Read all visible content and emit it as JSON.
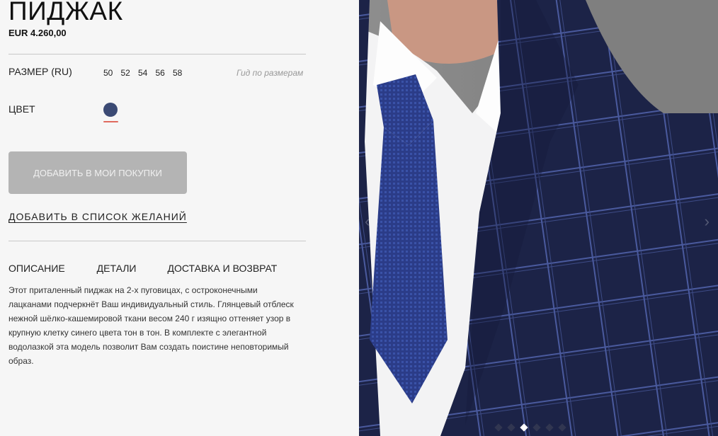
{
  "product": {
    "title": "ПИДЖАК",
    "price": "EUR 4.260,00"
  },
  "size": {
    "label": "РАЗМЕР (RU)",
    "options": [
      "50",
      "52",
      "54",
      "56",
      "58"
    ],
    "guide": "Гид по размерам"
  },
  "color": {
    "label": "ЦВЕТ",
    "swatch_hex": "#3b4a74",
    "selected_marker_hex": "#e06a5e"
  },
  "actions": {
    "add_to_cart": "ДОБАВИТЬ В МОИ ПОКУПКИ",
    "add_to_wishlist": "ДОБАВИТЬ В СПИСОК ЖЕЛАНИЙ"
  },
  "tabs": [
    "ОПИСАНИЕ",
    "ДЕТАЛИ",
    "ДОСТАВКА И ВОЗВРАТ"
  ],
  "description": "Этот приталенный пиджак на 2-х пуговицах, с остроконечными лацканами подчеркнёт Ваш индивидуальный стиль. Глянцевый отблеск нежной шёлко-кашемировой ткани весом 240 г изящно оттеняет узор в крупную клетку синего цвета тон в тон. В комплекте с элегантной водолазкой эта модель позволит Вам создать поистине неповторимый образ.",
  "gallery": {
    "image": "blue-check-jacket-with-tie-photo",
    "dots_count": 6,
    "active_dot_index": 2
  }
}
